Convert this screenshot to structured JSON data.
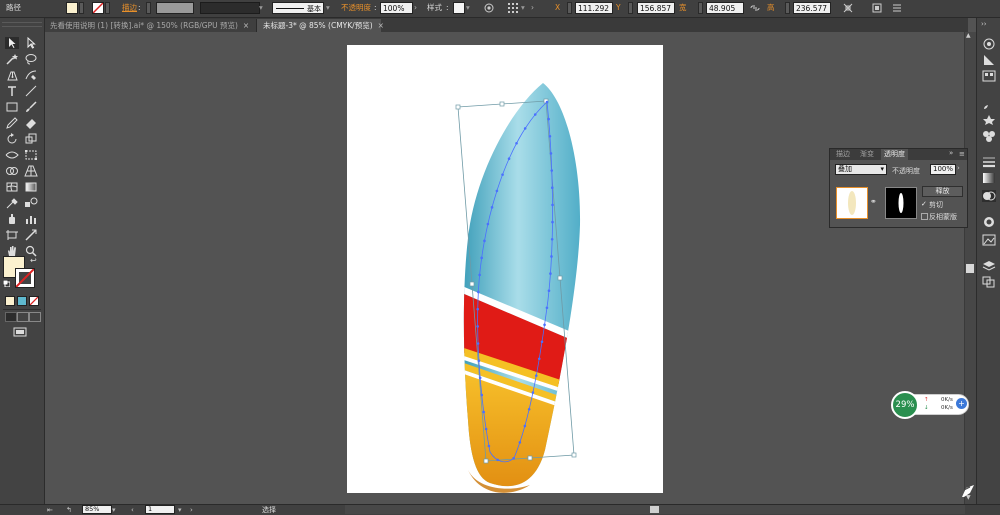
{
  "control_bar": {
    "path_label": "路径",
    "stroke_label": "描边",
    "brush_label": "基本",
    "opacity_label": "不透明度",
    "opacity_value": "100%",
    "style_label": "样式",
    "x_label": "X",
    "x_value": "111.292",
    "y_label": "Y",
    "y_value": "156.857",
    "width_label": "宽",
    "width_value": "48.905",
    "height_label": "高",
    "height_value": "236.577",
    "fill_color": "#fbf1cf"
  },
  "tabs": [
    {
      "label": "先看使用说明 (1) [转换].ai* @ 150% (RGB/GPU 预览)",
      "active": false
    },
    {
      "label": "未标题-3* @ 85% (CMYK/预览)",
      "active": true
    }
  ],
  "transparency_panel": {
    "tabs": [
      "描边",
      "渐变",
      "透明度"
    ],
    "blend_mode": "叠加",
    "opacity_label": "不透明度",
    "opacity_value": "100%",
    "release_button": "释放",
    "clip_label": "剪切",
    "invert_mask_label": "反相蒙版"
  },
  "net_widget": {
    "percent": "29%",
    "upload": "0K/s",
    "download": "0K/s"
  },
  "status_bar": {
    "zoom": "85%",
    "page": "1",
    "tool": "选择"
  },
  "colors": {
    "board_blue": "#5fb9cf",
    "board_red": "#e01b16",
    "board_yellow": "#f2a91e",
    "path_blue": "#4a70ff",
    "bbox": "#6f9aa6"
  }
}
